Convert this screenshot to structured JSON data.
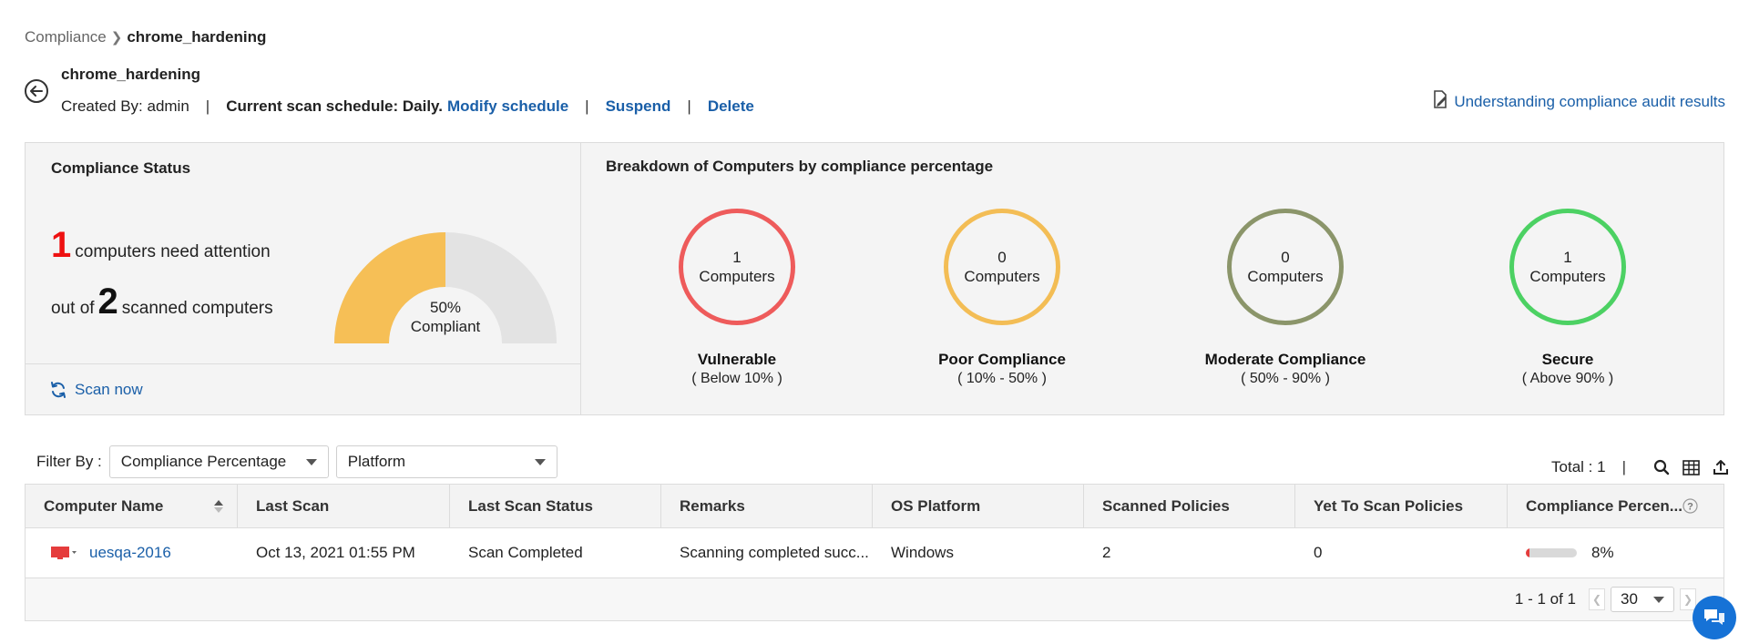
{
  "breadcrumb": {
    "parent": "Compliance",
    "current": "chrome_hardening"
  },
  "header": {
    "title": "chrome_hardening",
    "created_by": "Created By: admin",
    "schedule": "Current scan schedule: Daily.",
    "modify_schedule": "Modify schedule",
    "suspend": "Suspend",
    "delete": "Delete",
    "help_link": "Understanding compliance audit results"
  },
  "status": {
    "title": "Compliance Status",
    "attention_count": "1",
    "attention_text": "computers need attention",
    "out_of": "out of",
    "scanned_count": "2",
    "scanned_text": "scanned computers",
    "gauge_percent": "50%",
    "gauge_label": "Compliant",
    "gauge_value": 50,
    "scan_now": "Scan now"
  },
  "breakdown": {
    "title": "Breakdown of Computers by compliance percentage",
    "unit": "Computers",
    "items": [
      {
        "count": "1",
        "label": "Vulnerable",
        "range": "( Below 10% )",
        "color": "#ee5b5b"
      },
      {
        "count": "0",
        "label": "Poor Compliance",
        "range": "( 10% - 50% )",
        "color": "#f3bd55"
      },
      {
        "count": "0",
        "label": "Moderate Compliance",
        "range": "( 50% - 90% )",
        "color": "#8b956a"
      },
      {
        "count": "1",
        "label": "Secure",
        "range": "( Above 90% )",
        "color": "#4cd163"
      }
    ]
  },
  "filter": {
    "label": "Filter By :",
    "compliance": "Compliance Percentage",
    "platform": "Platform"
  },
  "tools": {
    "total": "Total : 1"
  },
  "table": {
    "columns": [
      "Computer Name",
      "Last Scan",
      "Last Scan Status",
      "Remarks",
      "OS Platform",
      "Scanned Policies",
      "Yet To Scan Policies",
      "Compliance Percen..."
    ],
    "rows": [
      {
        "computer": "uesqa-2016",
        "last_scan": "Oct 13, 2021 01:55 PM",
        "status": "Scan Completed",
        "remarks": "Scanning completed succ...",
        "os": "Windows",
        "scanned": "2",
        "yet_to_scan": "0",
        "compliance": "8%",
        "compliance_value": 8
      }
    ],
    "pagination": "1 - 1 of 1",
    "page_size": "30"
  },
  "colors": {
    "accent": "#1a5fa8",
    "gauge_fill": "#f6bf56",
    "gauge_track": "#e3e3e3",
    "attention": "#e11111"
  },
  "icons": [
    "back-arrow-icon",
    "document-edit-icon",
    "refresh-icon",
    "chevron-right-icon",
    "caret-down-icon",
    "search-icon",
    "table-columns-icon",
    "export-icon",
    "monitor-icon",
    "help-circle-icon",
    "chat-icon",
    "sort-icon"
  ]
}
